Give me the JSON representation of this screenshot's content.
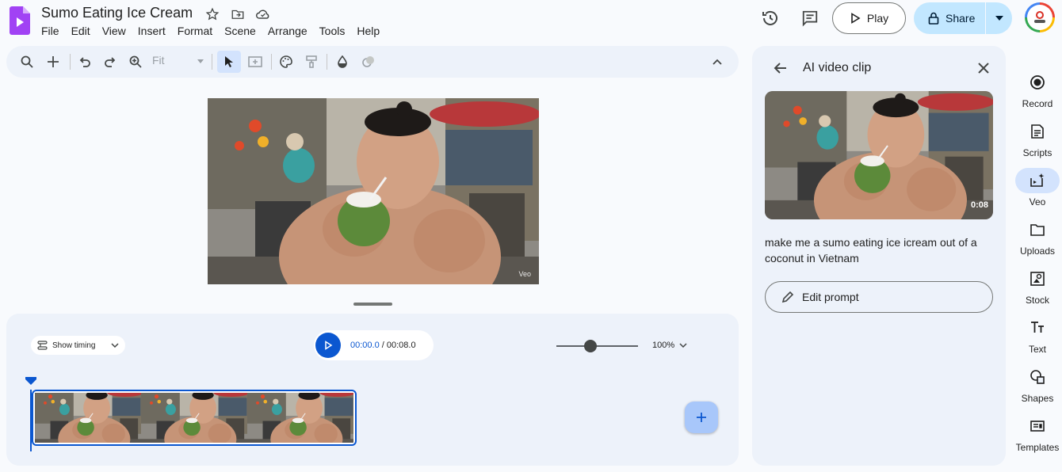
{
  "app": {
    "doc_title": "Sumo Eating Ice Cream",
    "menu": [
      "File",
      "Edit",
      "View",
      "Insert",
      "Format",
      "Scene",
      "Arrange",
      "Tools",
      "Help"
    ],
    "play_label": "Play",
    "share_label": "Share"
  },
  "toolbar": {
    "fit_label": "Fit"
  },
  "canvas": {
    "watermark": "Veo"
  },
  "timeline": {
    "show_timing_label": "Show timing",
    "current_time": "00:00.0",
    "separator": " / ",
    "total_time": "00:08.0",
    "zoom_label": "100%",
    "zoom_slider_fraction": 0.42
  },
  "side_panel": {
    "title": "AI video clip",
    "duration": "0:08",
    "prompt": "make me a sumo eating ice icream out of a coconut in Vietnam",
    "edit_prompt_label": "Edit prompt"
  },
  "rail": [
    {
      "label": "Record",
      "icon": "record-icon",
      "active": false
    },
    {
      "label": "Scripts",
      "icon": "scripts-icon",
      "active": false
    },
    {
      "label": "Veo",
      "icon": "veo-icon",
      "active": true
    },
    {
      "label": "Uploads",
      "icon": "folder-icon",
      "active": false
    },
    {
      "label": "Stock",
      "icon": "stock-icon",
      "active": false
    },
    {
      "label": "Text",
      "icon": "text-icon",
      "active": false
    },
    {
      "label": "Shapes",
      "icon": "shapes-icon",
      "active": false
    },
    {
      "label": "Templates",
      "icon": "templates-icon",
      "active": false
    }
  ],
  "colors": {
    "accent": "#0b57d0",
    "share_bg": "#c2e7ff",
    "panel_bg": "#edf2fa",
    "logo": "#a142f4"
  }
}
